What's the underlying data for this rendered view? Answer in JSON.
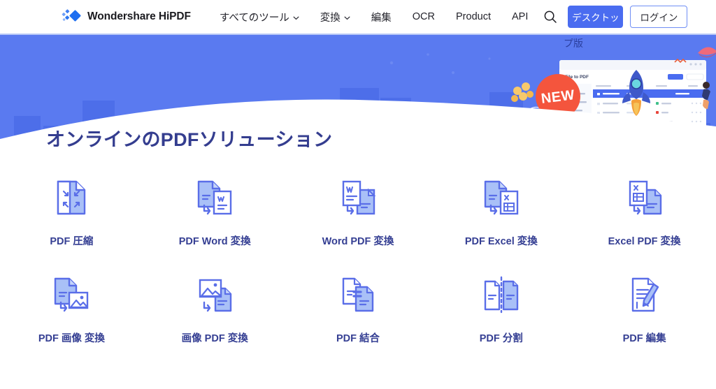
{
  "header": {
    "logo_icon": "wondershare-diamond-logo",
    "brand": "Wondershare HiPDF",
    "nav": [
      {
        "label": "すべてのツール",
        "has_chevron": true,
        "icon": "chevron-down-icon"
      },
      {
        "label": "変換",
        "has_chevron": true,
        "icon": "chevron-down-icon"
      },
      {
        "label": "編集",
        "has_chevron": false
      },
      {
        "label": "OCR",
        "has_chevron": false
      },
      {
        "label": "Product",
        "has_chevron": false
      },
      {
        "label": "API",
        "has_chevron": false
      }
    ],
    "search_icon": "search-icon",
    "desktop_button": "デスクトッ",
    "login_button": "ログイン",
    "primary_color": "#4a6cf0",
    "outline_border_color": "#6f8ef5"
  },
  "hero": {
    "background_color": "#5a7af0",
    "tooltip_text": "プ版",
    "new_badge": "NEW",
    "new_badge_color": "#f4553d",
    "app_window_title": "File to PDF",
    "art_elements": [
      "city-skyline-silhouette",
      "app-window-mockup",
      "rocket-illustration",
      "parachute-character-left",
      "parachute-character-right",
      "balloon-cluster"
    ]
  },
  "page_title": "オンラインのPDFソリューション",
  "title_color": "#343d8f",
  "tools": [
    {
      "label": "PDF 圧縮",
      "icon": "pdf-compress-icon"
    },
    {
      "label": "PDF Word 変換",
      "icon": "pdf-to-word-icon"
    },
    {
      "label": "Word PDF 変換",
      "icon": "word-to-pdf-icon"
    },
    {
      "label": "PDF Excel 変換",
      "icon": "pdf-to-excel-icon"
    },
    {
      "label": "Excel PDF 変換",
      "icon": "excel-to-pdf-icon"
    },
    {
      "label": "PDF 画像 変換",
      "icon": "pdf-to-image-icon"
    },
    {
      "label": "画像 PDF 変換",
      "icon": "image-to-pdf-icon"
    },
    {
      "label": "PDF 結合",
      "icon": "pdf-merge-icon"
    },
    {
      "label": "PDF 分割",
      "icon": "pdf-split-icon"
    },
    {
      "label": "PDF 編集",
      "icon": "pdf-edit-icon"
    }
  ],
  "icon_colors": {
    "stroke": "#5a6ee8",
    "fill": "#a9c0f7"
  }
}
